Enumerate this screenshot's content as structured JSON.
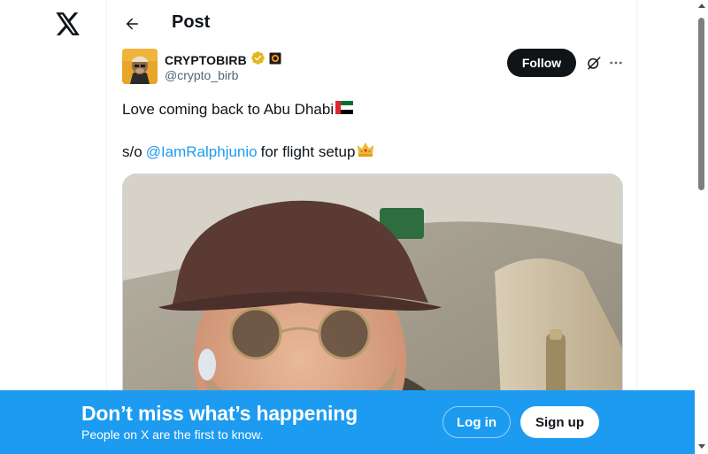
{
  "nav": {
    "logo_icon": "x-logo-icon"
  },
  "header": {
    "back_icon": "arrow-left-icon",
    "title": "Post"
  },
  "post": {
    "author": {
      "display_name": "CRYPTOBIRB",
      "handle": "@crypto_birb",
      "verified_icon": "gold-verified-badge-icon",
      "affiliate_icon": "affiliate-badge-icon"
    },
    "follow_label": "Follow",
    "grok_icon": "grok-icon",
    "more_icon": "more-dots-icon",
    "line1": "Love coming back to Abu Dhabi",
    "line1_emoji": "uae-flag-emoji",
    "line2_prefix": "s/o",
    "mention": "@IamRalphjunio",
    "line2_suffix": "for flight setup",
    "line2_emoji": "crown-emoji",
    "media_description": "selfie-in-airplane-seat"
  },
  "banner": {
    "title": "Don’t miss what’s happening",
    "subtitle": "People on X are the first to know.",
    "login_label": "Log in",
    "signup_label": "Sign up"
  },
  "colors": {
    "accent": "#1d9bf0",
    "text": "#0f1419",
    "secondary": "#536471",
    "verified_gold": "#e2b719"
  }
}
